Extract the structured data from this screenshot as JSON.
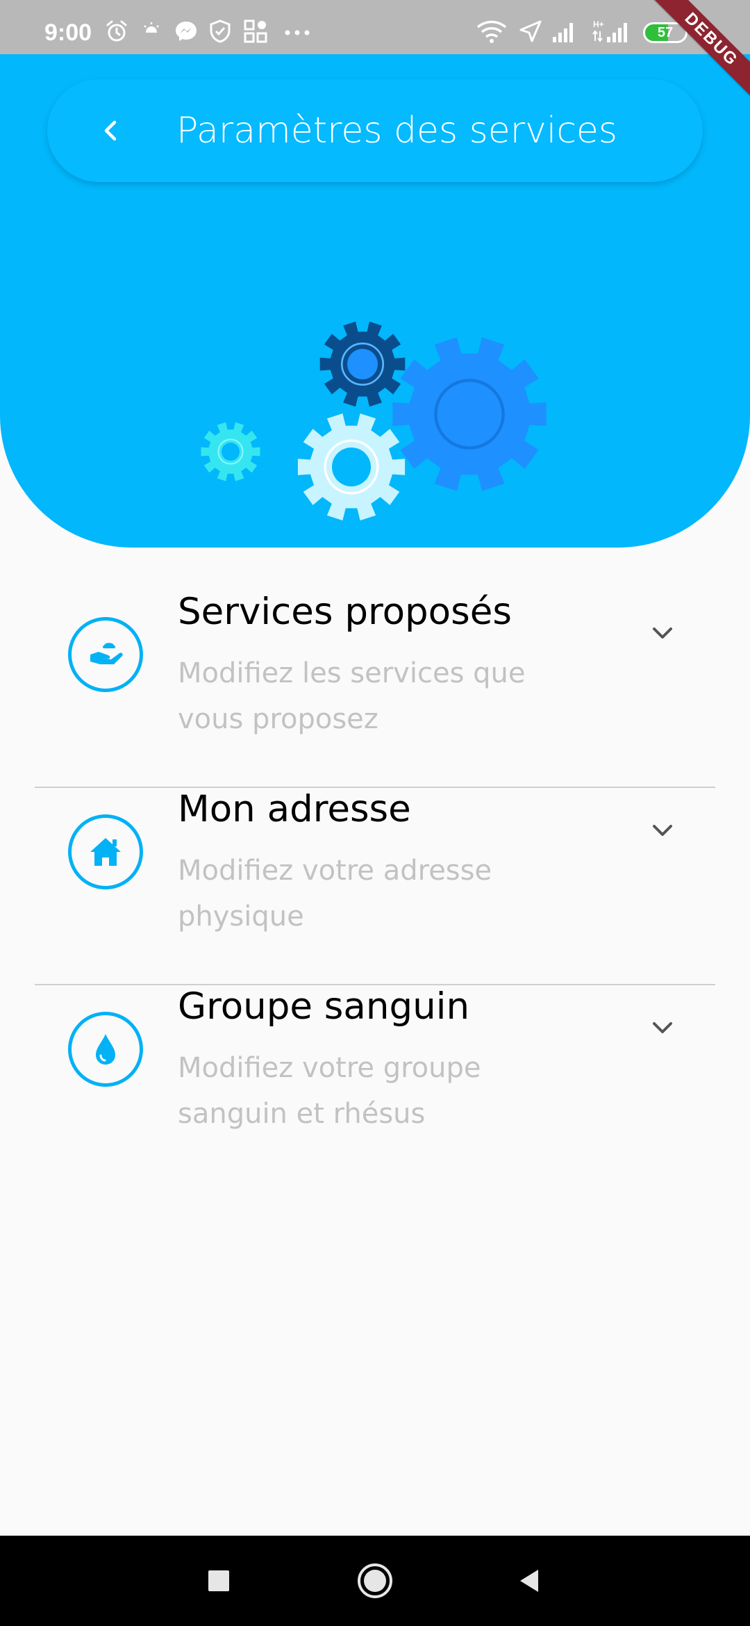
{
  "status_bar": {
    "time": "9:00",
    "battery_percent": 57,
    "battery_label": "57",
    "icons": [
      "alarm-icon",
      "weather-icon",
      "messenger-icon",
      "shield-icon",
      "apps-icon",
      "more-dots-icon",
      "wifi-icon",
      "location-icon",
      "signal-icon",
      "network-hplus-icon",
      "battery-icon"
    ]
  },
  "debug_banner": "DEBUG",
  "header": {
    "title": "Paramètres des services",
    "back_icon": "chevron-left-icon",
    "illustration": "gears-illustration",
    "color": "#02b7fb"
  },
  "settings": [
    {
      "icon": "hand-service-icon",
      "title": "Services proposés",
      "subtitle": "Modifiez les services que vous proposez"
    },
    {
      "icon": "home-icon",
      "title": "Mon adresse",
      "subtitle": "Modifiez votre adresse physique"
    },
    {
      "icon": "blood-drop-icon",
      "title": "Groupe sanguin",
      "subtitle": "Modifiez votre groupe sanguin et rhésus"
    }
  ],
  "nav_bar": {
    "icons": [
      "recents-square-icon",
      "home-circle-icon",
      "back-triangle-icon"
    ]
  }
}
